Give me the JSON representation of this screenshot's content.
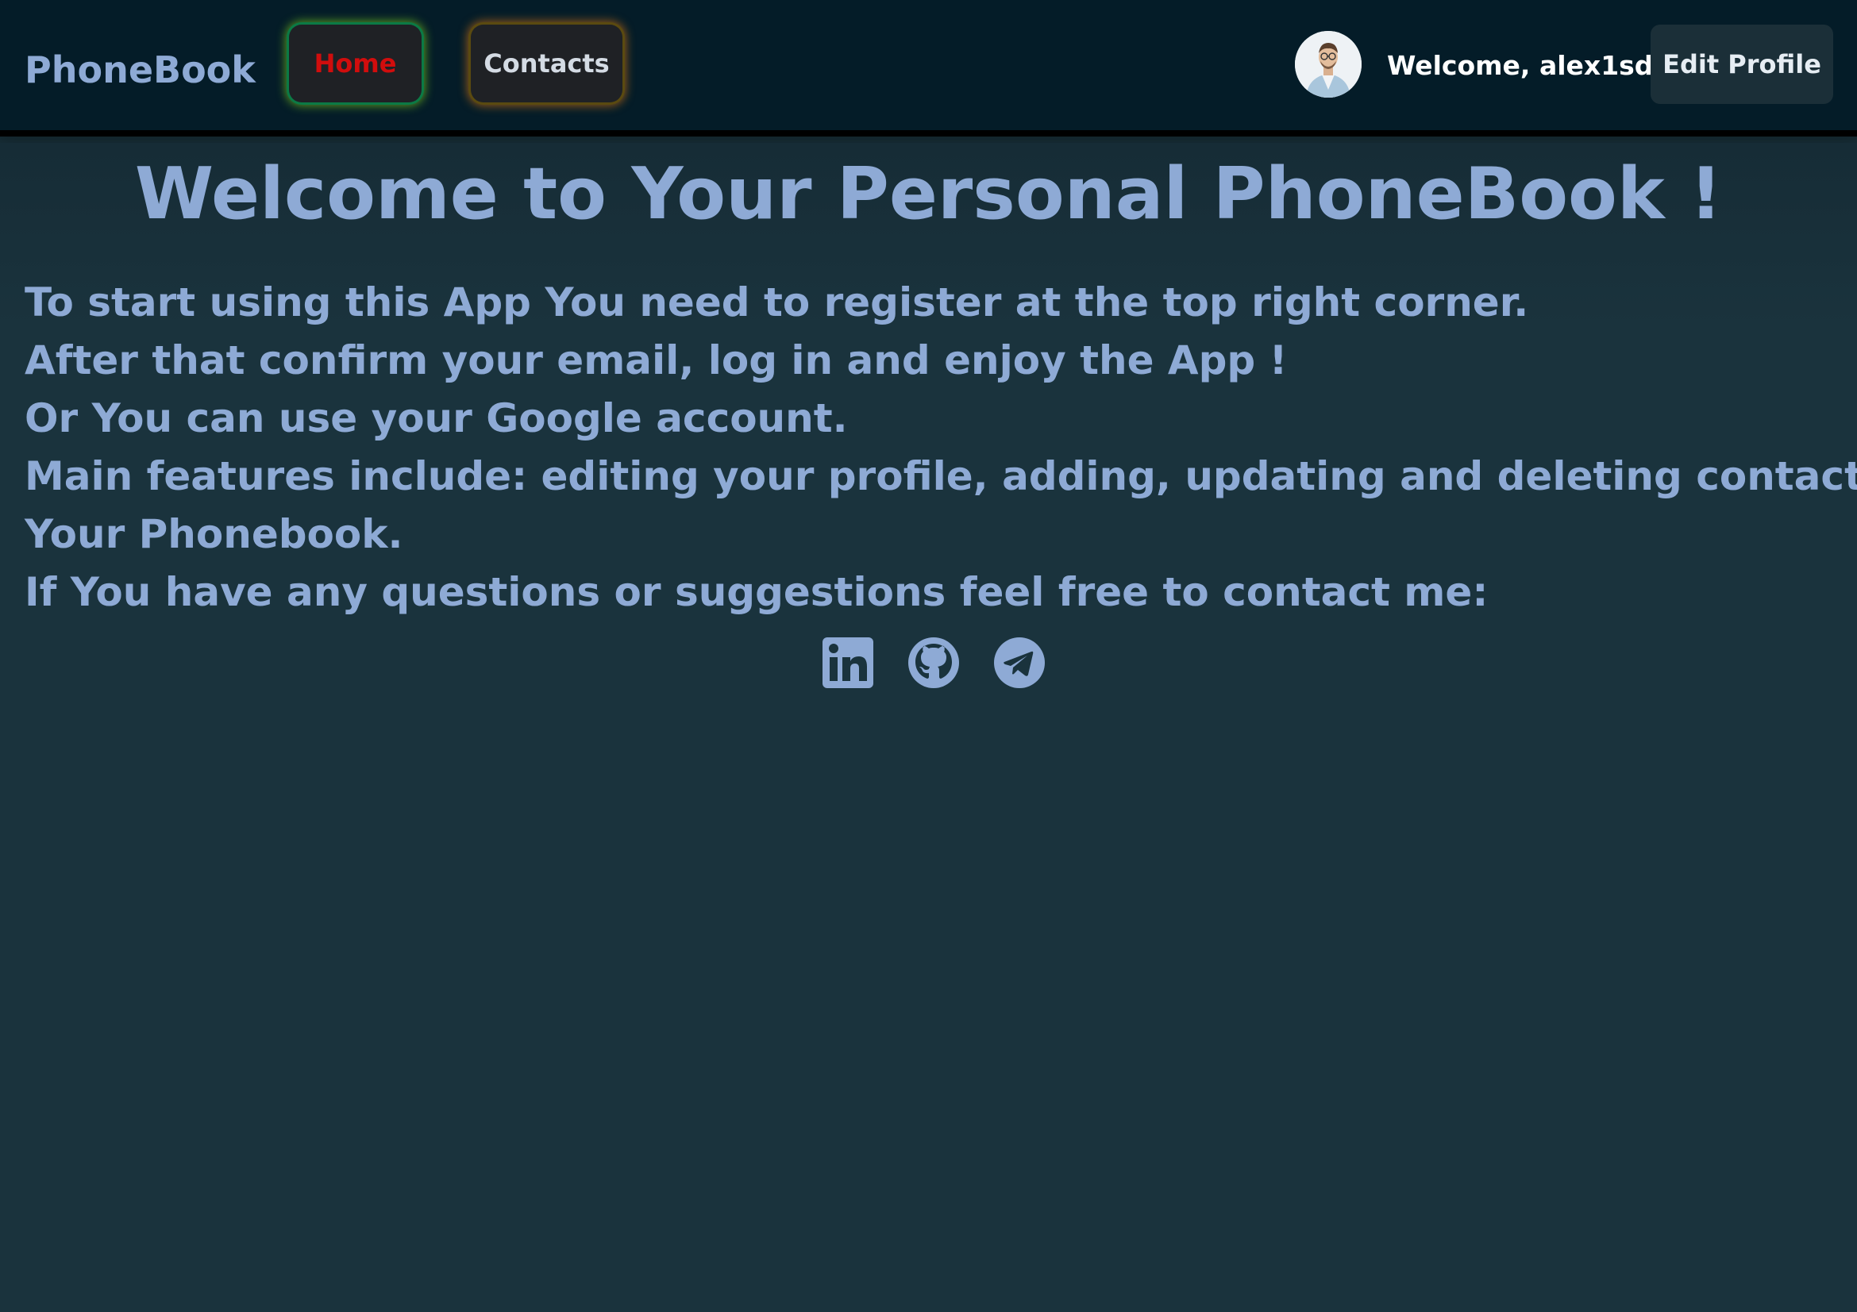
{
  "header": {
    "logo": "PhoneBook",
    "nav": {
      "home_label": "Home",
      "contacts_label": "Contacts"
    },
    "user": {
      "welcome_text": "Welcome, alex1sd",
      "edit_profile_label": "Edit Profile"
    }
  },
  "main": {
    "title": "Welcome to Your Personal PhoneBook !",
    "paragraphs": [
      "To start using this App You need to register at the top right corner.",
      "After that confirm your email, log in and enjoy the App !",
      "Or You can use your Google account.",
      "Main features include: editing your profile, adding, updating and deleting contacts in",
      "Your Phonebook.",
      "If You have any questions or suggestions feel free to contact me:"
    ],
    "socials": [
      "linkedin-icon",
      "github-icon",
      "telegram-icon"
    ]
  },
  "colors": {
    "page_background": "#1a333d",
    "header_background": "#041c28",
    "text_primary": "#8eaad5",
    "home_active": "#d10d0d",
    "button_background": "#1f2125"
  }
}
